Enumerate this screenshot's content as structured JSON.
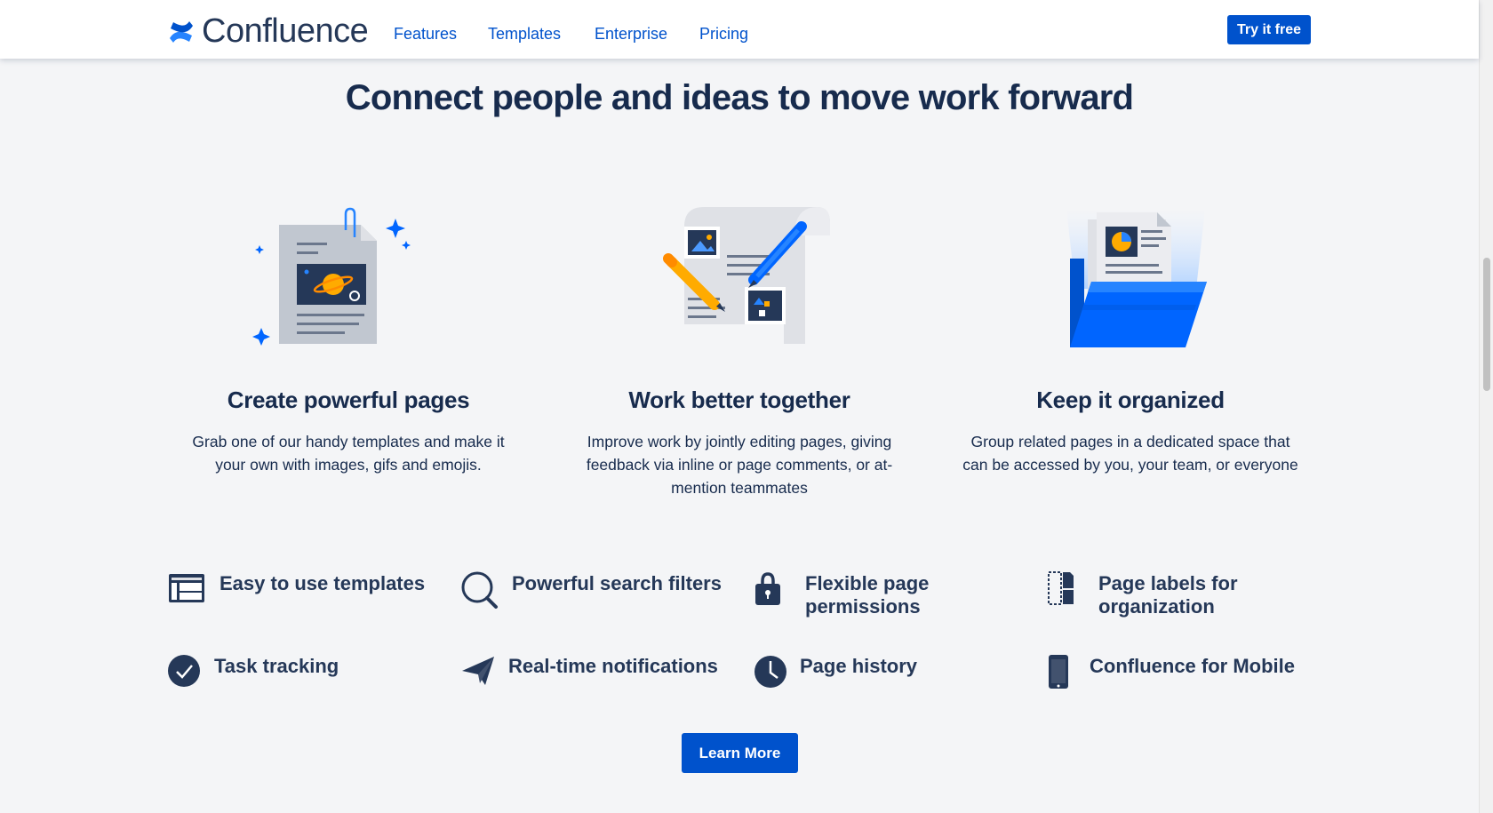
{
  "brand": {
    "name": "Confluence",
    "color": "#0052cc"
  },
  "nav": {
    "links": [
      "Features",
      "Templates",
      "Enterprise",
      "Pricing"
    ],
    "cta": "Try it free"
  },
  "hero": {
    "title": "Connect people and ideas to move work forward"
  },
  "features": [
    {
      "title": "Create powerful pages",
      "text": "Grab one of our handy templates and make it your own with images, gifs and emojis."
    },
    {
      "title": "Work better together",
      "text": "Improve work by jointly editing pages, giving feedback via inline or page comments, or at-mention teammates"
    },
    {
      "title": "Keep it organized",
      "text": "Group related pages in a dedicated space that can be accessed by you, your team, or everyone"
    }
  ],
  "mini_features": [
    {
      "label": "Easy to use templates",
      "icon": "template-layout-icon"
    },
    {
      "label": "Powerful search filters",
      "icon": "search-icon"
    },
    {
      "label": "Flexible page permissions",
      "icon": "lock-icon"
    },
    {
      "label": "Page labels for organization",
      "icon": "page-labels-icon"
    },
    {
      "label": "Task tracking",
      "icon": "checkmark-circle-icon"
    },
    {
      "label": "Real-time notifications",
      "icon": "paper-plane-icon"
    },
    {
      "label": "Page history",
      "icon": "clock-icon"
    },
    {
      "label": "Confluence for Mobile",
      "icon": "mobile-phone-icon"
    }
  ],
  "learn_more": "Learn More"
}
